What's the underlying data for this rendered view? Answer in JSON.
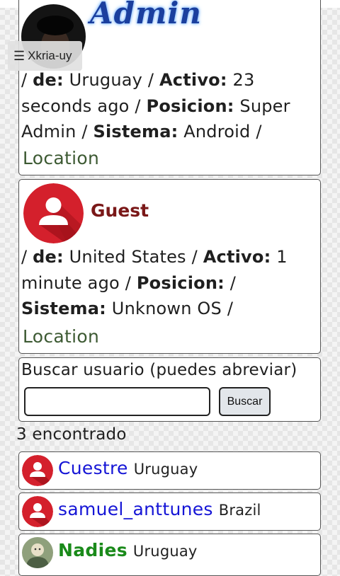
{
  "menu": {
    "icon": "hamburger-icon",
    "label": "Xkria-uy"
  },
  "users": [
    {
      "name": "Admin",
      "avatar": "admin-photo",
      "sep0": "/",
      "country_label": "de:",
      "country": "Uruguay",
      "sep1": "/",
      "active_label": "Activo:",
      "active": "23 seconds ago",
      "sep2": "/",
      "position_label": "Posicion:",
      "position": "Super Admin",
      "sep3": "/",
      "system_label": "Sistema:",
      "system": "Android",
      "sep4": "/",
      "location_link": "Location"
    },
    {
      "name": "Guest",
      "avatar": "default-user-icon",
      "sep0": "/",
      "country_label": "de:",
      "country": "United States",
      "sep1": "/",
      "active_label": "Activo:",
      "active": "1 minute ago",
      "sep2": "/",
      "position_label": "Posicion:",
      "position": "",
      "sep3": "/",
      "system_label": "Sistema:",
      "system": "Unknown OS",
      "sep4": "/",
      "location_link": "Location"
    }
  ],
  "search": {
    "label": "Buscar usuario (puedes abreviar)",
    "value": "",
    "button": "Buscar"
  },
  "results_count": "3 encontrado",
  "results": [
    {
      "name": "Cuestre",
      "country": "Uruguay",
      "color": "#1515d6",
      "avatar": "default-user-icon"
    },
    {
      "name": "samuel_anttunes",
      "country": "Brazil",
      "color": "#1515d6",
      "avatar": "default-user-icon"
    },
    {
      "name": "Nadies",
      "country": "Uruguay",
      "color": "#1a8a1a",
      "avatar": "user-photo"
    }
  ],
  "colors": {
    "admin_name": "#1b3f9e",
    "guest_name": "#7a1818",
    "location_link": "#3d5a33",
    "avatar_red": "#d4202c"
  }
}
